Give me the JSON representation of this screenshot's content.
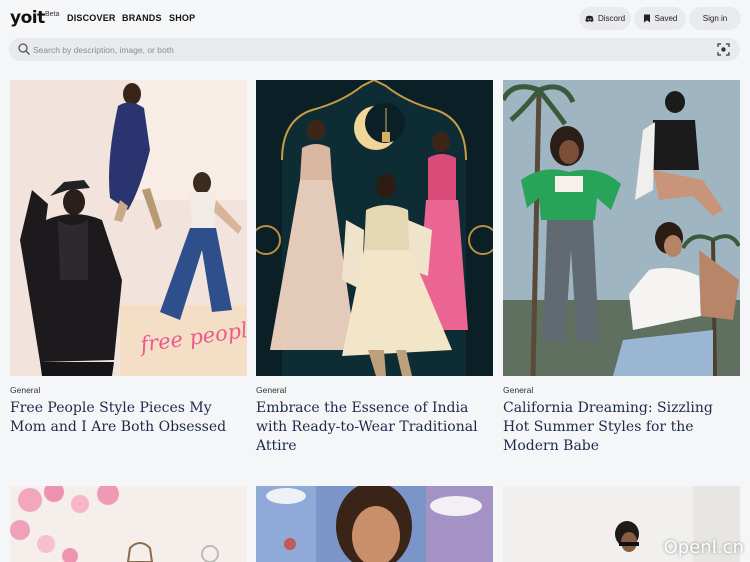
{
  "brand": {
    "logo": "yoit",
    "badge": "Beta"
  },
  "nav": [
    {
      "label": "DISCOVER"
    },
    {
      "label": "BRANDS"
    },
    {
      "label": "SHOP"
    }
  ],
  "actions": {
    "discord": "Discord",
    "saved": "Saved",
    "signin": "Sign in"
  },
  "search": {
    "placeholder": "Search by description, image, or both"
  },
  "cards": [
    {
      "category": "General",
      "title": "Free People Style Pieces My Mom and I Are Both Obsessed",
      "overlay": "free people"
    },
    {
      "category": "General",
      "title": "Embrace the Essence of India with Ready-to-Wear Traditional Attire"
    },
    {
      "category": "General",
      "title": "California Dreaming: Sizzling Hot Summer Styles for the Modern Babe"
    }
  ],
  "watermark": "OpenI.cn"
}
